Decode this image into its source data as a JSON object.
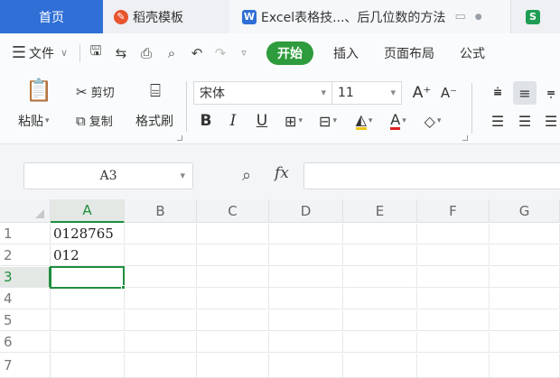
{
  "tabs": {
    "home": "首页",
    "daoke": "稻壳模板",
    "excel": "Excel表格技...、后几位数的方法",
    "s_logo": "S",
    "w_logo": "W"
  },
  "menu": {
    "file": "文件",
    "start": "开始",
    "insert": "插入",
    "page_layout": "页面布局",
    "formula": "公式"
  },
  "ribbon": {
    "paste": "粘贴",
    "cut": "剪切",
    "copy": "复制",
    "format_painter": "格式刷",
    "font_name": "宋体",
    "font_size": "11",
    "bold": "B",
    "italic": "I",
    "underline": "U"
  },
  "formula_bar": {
    "name_box": "A3",
    "fx": "fx"
  },
  "sheet": {
    "columns": [
      "A",
      "B",
      "C",
      "D",
      "E",
      "F",
      "G"
    ],
    "rows": [
      "1",
      "2",
      "3",
      "4",
      "5",
      "6",
      "7"
    ],
    "cells": {
      "A1": "0128765",
      "A2": "012"
    }
  },
  "colors": {
    "accent": "#2f6fd6",
    "start_green": "#2e9b3c",
    "selection": "#1e8e3e"
  }
}
